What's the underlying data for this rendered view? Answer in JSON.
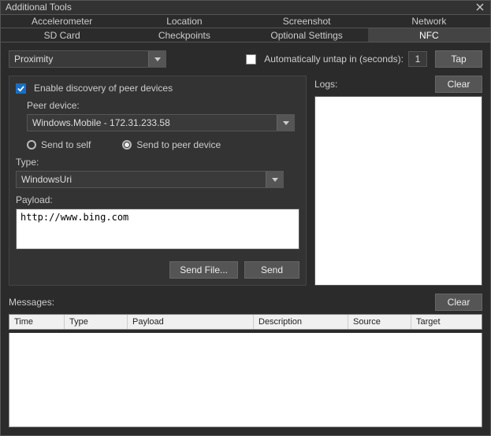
{
  "window": {
    "title": "Additional Tools"
  },
  "tabs1": [
    "Accelerometer",
    "Location",
    "Screenshot",
    "Network"
  ],
  "tabs2": [
    "SD Card",
    "Checkpoints",
    "Optional Settings",
    "NFC"
  ],
  "activeTab": "NFC",
  "proximity": {
    "selected": "Proximity"
  },
  "autoUntap": {
    "label": "Automatically untap in (seconds):",
    "value": "1"
  },
  "tapBtn": "Tap",
  "logs": {
    "label": "Logs:",
    "clear": "Clear"
  },
  "discovery": {
    "checked": true,
    "label": "Enable discovery of peer devices"
  },
  "peer": {
    "label": "Peer device:",
    "selected": "Windows.Mobile - 172.31.233.58"
  },
  "sendMode": {
    "self": "Send to self",
    "peer": "Send to peer device",
    "selected": "peer"
  },
  "type": {
    "label": "Type:",
    "selected": "WindowsUri"
  },
  "payload": {
    "label": "Payload:",
    "value": "http://www.bing.com"
  },
  "sendFileBtn": "Send File...",
  "sendBtn": "Send",
  "messages": {
    "label": "Messages:",
    "clear": "Clear",
    "columns": [
      "Time",
      "Type",
      "Payload",
      "Description",
      "Source",
      "Target"
    ]
  }
}
